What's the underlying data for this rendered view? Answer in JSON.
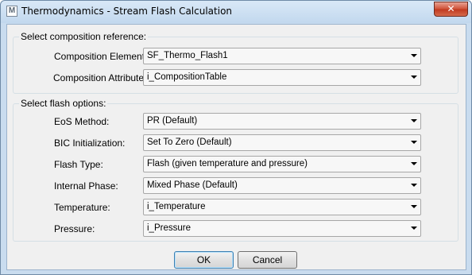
{
  "window": {
    "title": "Thermodynamics - Stream Flash Calculation",
    "app_icon_glyph": "M",
    "close_glyph": "✕"
  },
  "composition_group": {
    "title": "Select composition reference:",
    "element_label": "Composition Element:",
    "element_value": "SF_Thermo_Flash1",
    "attribute_label": "Composition Attribute:",
    "attribute_value": "i_CompositionTable"
  },
  "flash_group": {
    "title": "Select flash options:",
    "rows": [
      {
        "label": "EoS Method:",
        "value": "PR (Default)"
      },
      {
        "label": "BIC Initialization:",
        "value": "Set To Zero (Default)"
      },
      {
        "label": "Flash Type:",
        "value": "Flash (given temperature and pressure)"
      },
      {
        "label": "Internal Phase:",
        "value": "Mixed Phase (Default)"
      },
      {
        "label": "Temperature:",
        "value": "i_Temperature"
      },
      {
        "label": "Pressure:",
        "value": "i_Pressure"
      }
    ]
  },
  "buttons": {
    "ok": "OK",
    "cancel": "Cancel"
  }
}
